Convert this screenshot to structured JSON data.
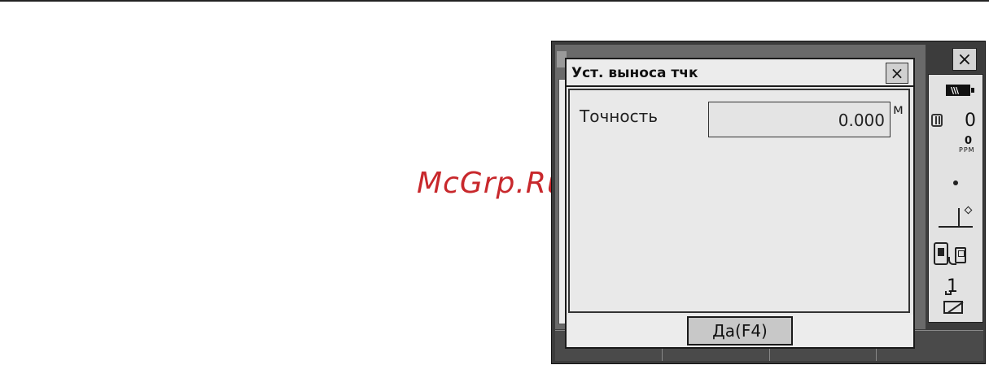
{
  "watermark": "McGrp.Ru",
  "dialog": {
    "title": "Уст. выноса тчк",
    "close_label": "×",
    "field_label": "Точность",
    "field_value": "0.000",
    "field_unit": "м",
    "ok_label": "Да(F4)"
  },
  "window": {
    "close_label": "×"
  },
  "status": {
    "prism_constant": "0",
    "ppm_value": "0",
    "ppm_label": "PPM",
    "input_mode": "1"
  },
  "icons": {
    "battery": "battery-icon",
    "prism": "prism-icon",
    "tilt": "tilt-icon",
    "bluetooth": "bluetooth-link-icon",
    "input_mode": "input-mode-icon",
    "pen": "pen-icon"
  },
  "colors": {
    "watermark": "#c8282c",
    "device_frame": "#3c3c3c",
    "dialog_bg": "#e8e8e8"
  }
}
